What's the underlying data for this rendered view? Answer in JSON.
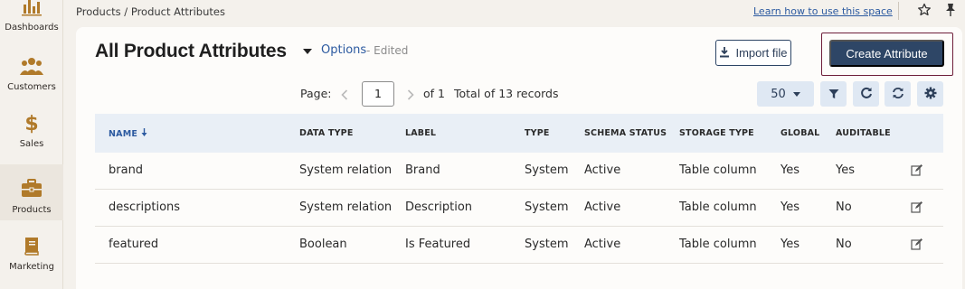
{
  "sidebar": {
    "items": [
      {
        "label": "Dashboards",
        "icon": "bar-chart-icon"
      },
      {
        "label": "Customers",
        "icon": "users-icon"
      },
      {
        "label": "Sales",
        "icon": "dollar-icon"
      },
      {
        "label": "Products",
        "icon": "briefcase-icon",
        "active": true
      },
      {
        "label": "Marketing",
        "icon": "book-icon"
      }
    ]
  },
  "topbar": {
    "breadcrumb": "Products / Product Attributes",
    "learn_link": "Learn how to use this space"
  },
  "header": {
    "title": "All Product Attributes",
    "options": "Options",
    "edited": "- Edited",
    "import_label": "Import file",
    "create_label": "Create Attribute"
  },
  "pagination": {
    "page_label": "Page:",
    "current_page": "1",
    "of_label": "of 1",
    "total_label": "Total of 13 records",
    "per_page": "50"
  },
  "table": {
    "columns": [
      "NAME",
      "DATA TYPE",
      "LABEL",
      "TYPE",
      "SCHEMA STATUS",
      "STORAGE TYPE",
      "GLOBAL",
      "AUDITABLE"
    ],
    "rows": [
      [
        "brand",
        "System relation",
        "Brand",
        "System",
        "Active",
        "Table column",
        "Yes",
        "Yes"
      ],
      [
        "descriptions",
        "System relation",
        "Description",
        "System",
        "Active",
        "Table column",
        "Yes",
        "No"
      ],
      [
        "featured",
        "Boolean",
        "Is Featured",
        "System",
        "Active",
        "Table column",
        "Yes",
        "No"
      ]
    ]
  },
  "colors": {
    "accent": "#2e4666",
    "link": "#2c5aa0",
    "icon_gold": "#b07a2a",
    "highlight_outline": "#6e1e3a"
  }
}
